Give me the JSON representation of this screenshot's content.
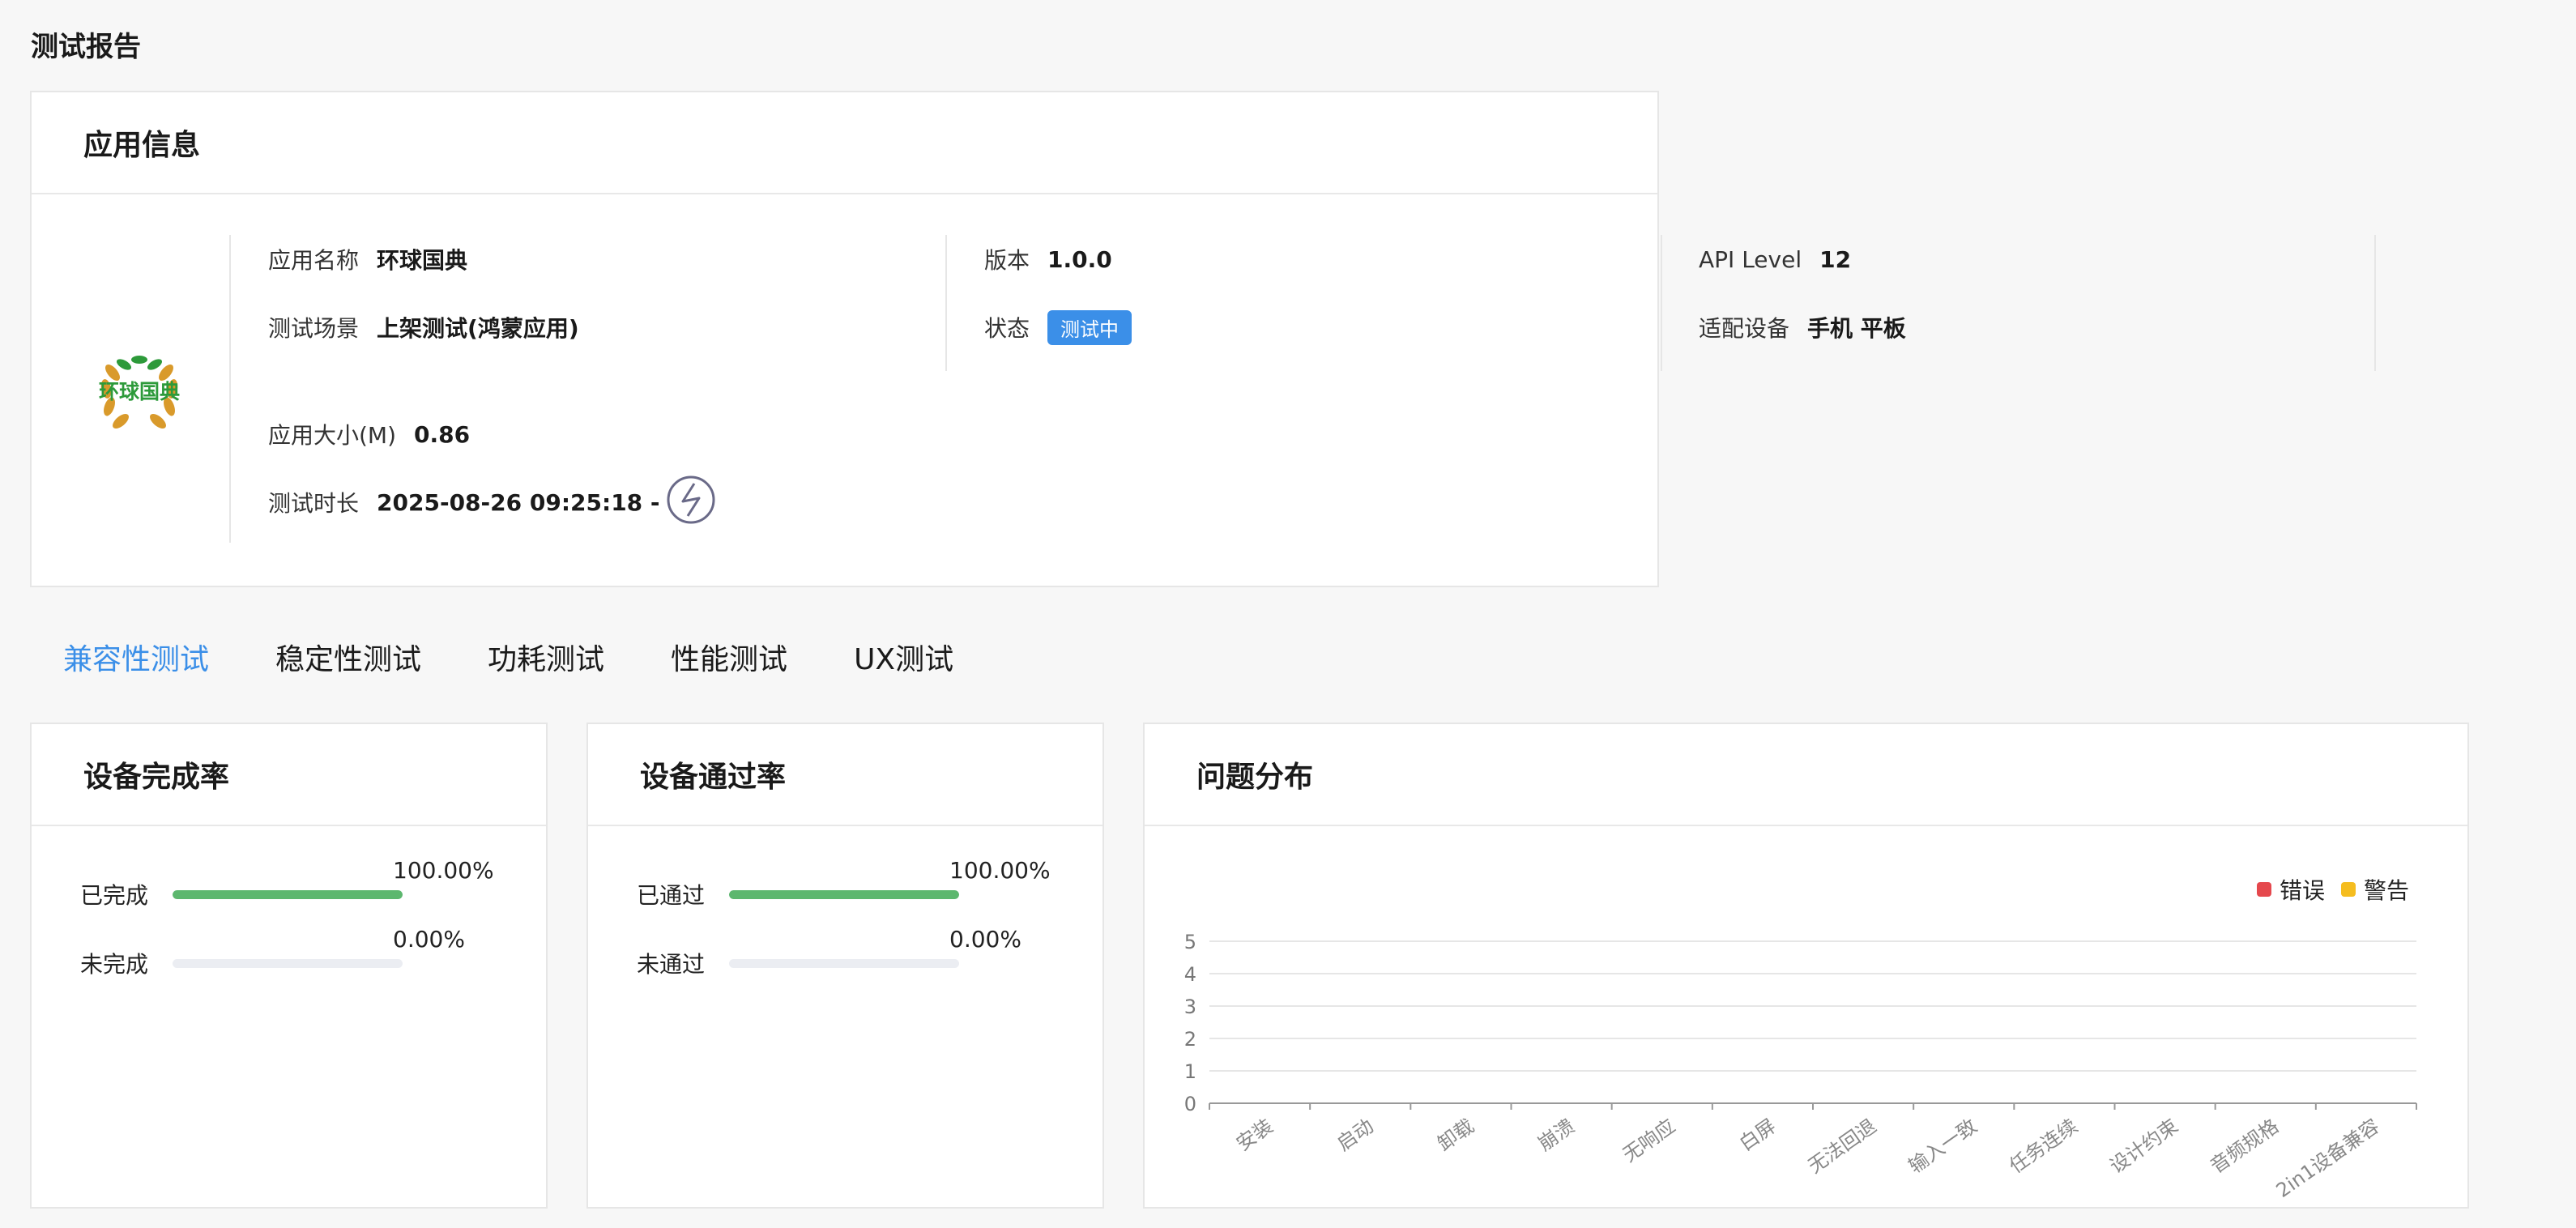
{
  "page": {
    "title": "测试报告"
  },
  "app_info": {
    "header": "应用信息",
    "fields": {
      "app_name": {
        "label": "应用名称",
        "value": "环球国典"
      },
      "scene": {
        "label": "测试场景",
        "value": "上架测试(鸿蒙应用)"
      },
      "version": {
        "label": "版本",
        "value": "1.0.0"
      },
      "status": {
        "label": "状态",
        "value": "测试中"
      },
      "api_level": {
        "label": "API Level",
        "value": "12"
      },
      "devices": {
        "label": "适配设备",
        "value": "手机 平板"
      },
      "size": {
        "label": "应用大小(M)",
        "value": "0.86"
      },
      "duration": {
        "label": "测试时长",
        "value": "2025-08-26 09:25:18 -"
      }
    },
    "logo_text": "环球国典",
    "status_color": "#3b8fe8"
  },
  "tabs": [
    {
      "label": "兼容性测试",
      "active": true
    },
    {
      "label": "稳定性测试",
      "active": false
    },
    {
      "label": "功耗测试",
      "active": false
    },
    {
      "label": "性能测试",
      "active": false
    },
    {
      "label": "UX测试",
      "active": false
    }
  ],
  "completion": {
    "title": "设备完成率",
    "rows": [
      {
        "label": "已完成",
        "percent_text": "100.00%",
        "fraction": 1.0
      },
      {
        "label": "未完成",
        "percent_text": "0.00%",
        "fraction": 0.0
      }
    ]
  },
  "pass_rate": {
    "title": "设备通过率",
    "rows": [
      {
        "label": "已通过",
        "percent_text": "100.00%",
        "fraction": 1.0
      },
      {
        "label": "未通过",
        "percent_text": "0.00%",
        "fraction": 0.0
      }
    ]
  },
  "issues": {
    "title": "问题分布",
    "legend": [
      {
        "name": "错误",
        "color": "#e5484d"
      },
      {
        "name": "警告",
        "color": "#f5bd1f"
      }
    ]
  },
  "chart_data": {
    "type": "bar",
    "title": "",
    "categories": [
      "安装",
      "启动",
      "卸载",
      "崩溃",
      "无响应",
      "白屏",
      "无法回退",
      "输入一致",
      "任务连续",
      "设计约束",
      "音频规格",
      "2in1设备兼容"
    ],
    "series": [
      {
        "name": "错误",
        "values": [
          0,
          0,
          0,
          0,
          0,
          0,
          0,
          0,
          0,
          0,
          0,
          0
        ]
      },
      {
        "name": "警告",
        "values": [
          0,
          0,
          0,
          0,
          0,
          0,
          0,
          0,
          0,
          0,
          0,
          0
        ]
      }
    ],
    "yticks": [
      "0",
      "1",
      "2",
      "3",
      "4",
      "5"
    ],
    "ylim": [
      0,
      5
    ],
    "grid": true,
    "legend_position": "top-right"
  }
}
